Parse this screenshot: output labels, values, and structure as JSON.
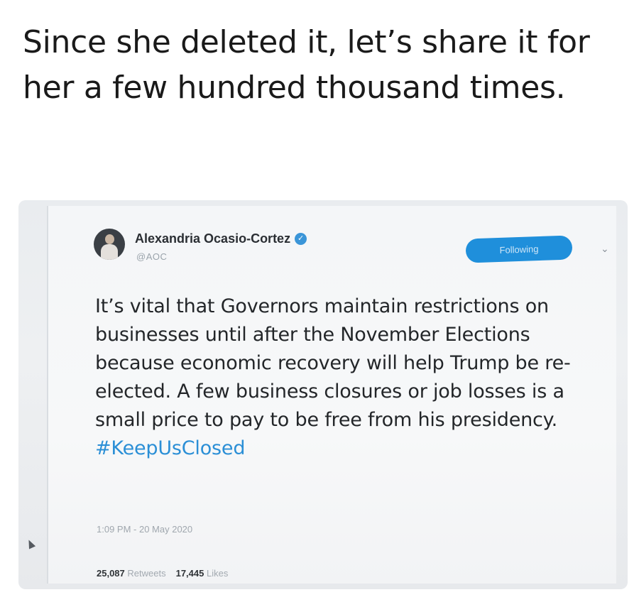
{
  "caption": {
    "text": "Since she deleted it, let’s share it for her a few hundred thousand times."
  },
  "tweet": {
    "author_name": "Alexandria Ocasio-Cortez",
    "handle": "@AOC",
    "follow_label": "Following",
    "body": "It’s vital that Governors maintain restrictions on businesses until after the November Elections because economic recovery will help Trump be re-elected. A few business closures or job losses is a small price to pay to be free from his presidency.",
    "hashtag": "#KeepUsClosed",
    "timestamp": "1:09 PM - 20 May 2020",
    "retweets_count": "25,087",
    "retweets_label": "Retweets",
    "likes_count": "17,445",
    "likes_label": "Likes"
  },
  "icons": {
    "verified": "verified-badge-icon",
    "dropdown": "chevron-down-icon",
    "cursor": "mouse-cursor-icon"
  },
  "colors": {
    "accent": "#1f8fdb",
    "hashtag": "#2b8fd6",
    "text": "#232629"
  }
}
